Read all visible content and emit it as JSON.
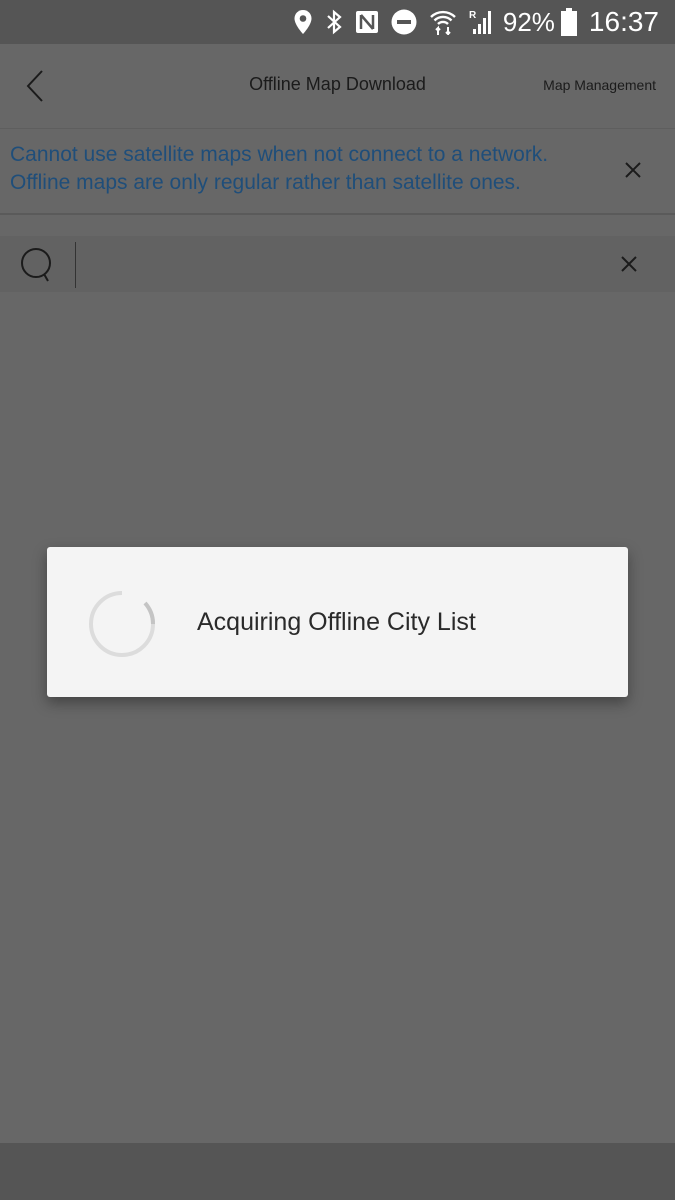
{
  "status_bar": {
    "icons": [
      "location-icon",
      "bluetooth-icon",
      "nfc-icon",
      "do-not-disturb-icon",
      "wifi-icon",
      "signal-roaming-icon",
      "battery-icon"
    ],
    "roaming_label": "R",
    "battery_percent": "92%",
    "time": "16:37"
  },
  "header": {
    "title": "Offline Map Download",
    "right_action": "Map Management",
    "back_icon": "chevron-left-icon"
  },
  "banner": {
    "message_line1": "Cannot use satellite maps when not connect to a network.",
    "message_line2": "Offline maps are only regular rather than satellite ones.",
    "close_icon": "close-icon",
    "text_color": "#1f6fb8"
  },
  "search": {
    "value": "",
    "placeholder": "",
    "search_icon": "search-icon",
    "clear_icon": "close-icon"
  },
  "dialog": {
    "message": "Acquiring Offline City List",
    "spinner_icon": "loading-spinner-icon"
  },
  "colors": {
    "overlay_background": "#676767",
    "status_bar": "#555555",
    "dialog_background": "#f4f4f4"
  }
}
